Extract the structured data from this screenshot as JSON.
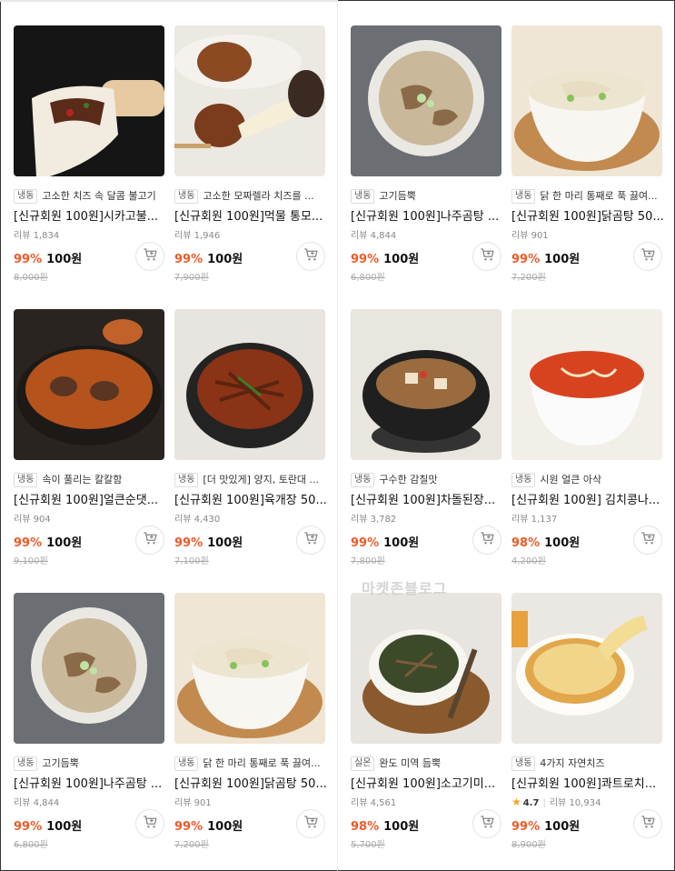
{
  "watermark": "마켓존블로그",
  "cart_icon": "cart-icon",
  "products": [
    {
      "badge": "냉동",
      "desc": "고소한 치즈 속 달콤 불고기",
      "title": "[신규회원 100원]시카고불...",
      "review": "리뷰 1,834",
      "rating": "",
      "discount": "99%",
      "price": "100원",
      "original": "8,000원",
      "image": "cheese-bulgogi-pizza"
    },
    {
      "badge": "냉동",
      "desc": "고소한 모짜렐라 치즈를 ...",
      "title": "[신규회원 100원]먹물 통모...",
      "review": "리뷰 1,946",
      "rating": "",
      "discount": "99%",
      "price": "100원",
      "original": "7,900원",
      "image": "mozzarella-corndog"
    },
    {
      "badge": "냉동",
      "desc": "고기듬뿍",
      "title": "[신규회원 100원]나주곰탕 ...",
      "review": "리뷰 4,844",
      "rating": "",
      "discount": "99%",
      "price": "100원",
      "original": "6,800원",
      "image": "gomtang"
    },
    {
      "badge": "냉동",
      "desc": "닭 한 마리 통째로 푹 끓여...",
      "title": "[신규회원 100원]닭곰탕 50...",
      "review": "리뷰 901",
      "rating": "",
      "discount": "99%",
      "price": "100원",
      "original": "7,200원",
      "image": "chicken-gomtang"
    },
    {
      "badge": "냉동",
      "desc": "속이 풀리는 칼칼함",
      "title": "[신규회원 100원]얼큰순댓...",
      "review": "리뷰 904",
      "rating": "",
      "discount": "99%",
      "price": "100원",
      "original": "9,100원",
      "image": "sundae-stew"
    },
    {
      "badge": "냉동",
      "desc": "[더 맛있게] 양지, 토란대 ...",
      "title": "[신규회원 100원]육개장 50...",
      "review": "리뷰 4,430",
      "rating": "",
      "discount": "99%",
      "price": "100원",
      "original": "7,100원",
      "image": "yukgaejang"
    },
    {
      "badge": "냉동",
      "desc": "구수한 감칠맛",
      "title": "[신규회원 100원]차돌된장...",
      "review": "리뷰 3,782",
      "rating": "",
      "discount": "99%",
      "price": "100원",
      "original": "7,800원",
      "image": "doenjang-stew"
    },
    {
      "badge": "냉동",
      "desc": "시원 얼큰 아삭",
      "title": "[신규회원 100원] 김치콩나...",
      "review": "리뷰 1,137",
      "rating": "",
      "discount": "98%",
      "price": "100원",
      "original": "4,200원",
      "image": "kimchi-sprout-soup"
    },
    {
      "badge": "냉동",
      "desc": "고기듬뿍",
      "title": "[신규회원 100원]나주곰탕 ...",
      "review": "리뷰 4,844",
      "rating": "",
      "discount": "99%",
      "price": "100원",
      "original": "6,800원",
      "image": "gomtang"
    },
    {
      "badge": "냉동",
      "desc": "닭 한 마리 통째로 푹 끓여...",
      "title": "[신규회원 100원]닭곰탕 50...",
      "review": "리뷰 901",
      "rating": "",
      "discount": "99%",
      "price": "100원",
      "original": "7,200원",
      "image": "chicken-gomtang"
    },
    {
      "badge": "실온",
      "desc": "완도 미역 듬뿍",
      "title": "[신규회원 100원]소고기미...",
      "review": "리뷰 4,561",
      "rating": "",
      "discount": "98%",
      "price": "100원",
      "original": "5,700원",
      "image": "seaweed-soup"
    },
    {
      "badge": "냉동",
      "desc": "4가지 자연치즈",
      "title": "[신규회원 100원]콰트로치...",
      "review": "리뷰 10,934",
      "rating": "4.7",
      "discount": "99%",
      "price": "100원",
      "original": "8,900원",
      "image": "quattro-cheese-pizza"
    }
  ]
}
